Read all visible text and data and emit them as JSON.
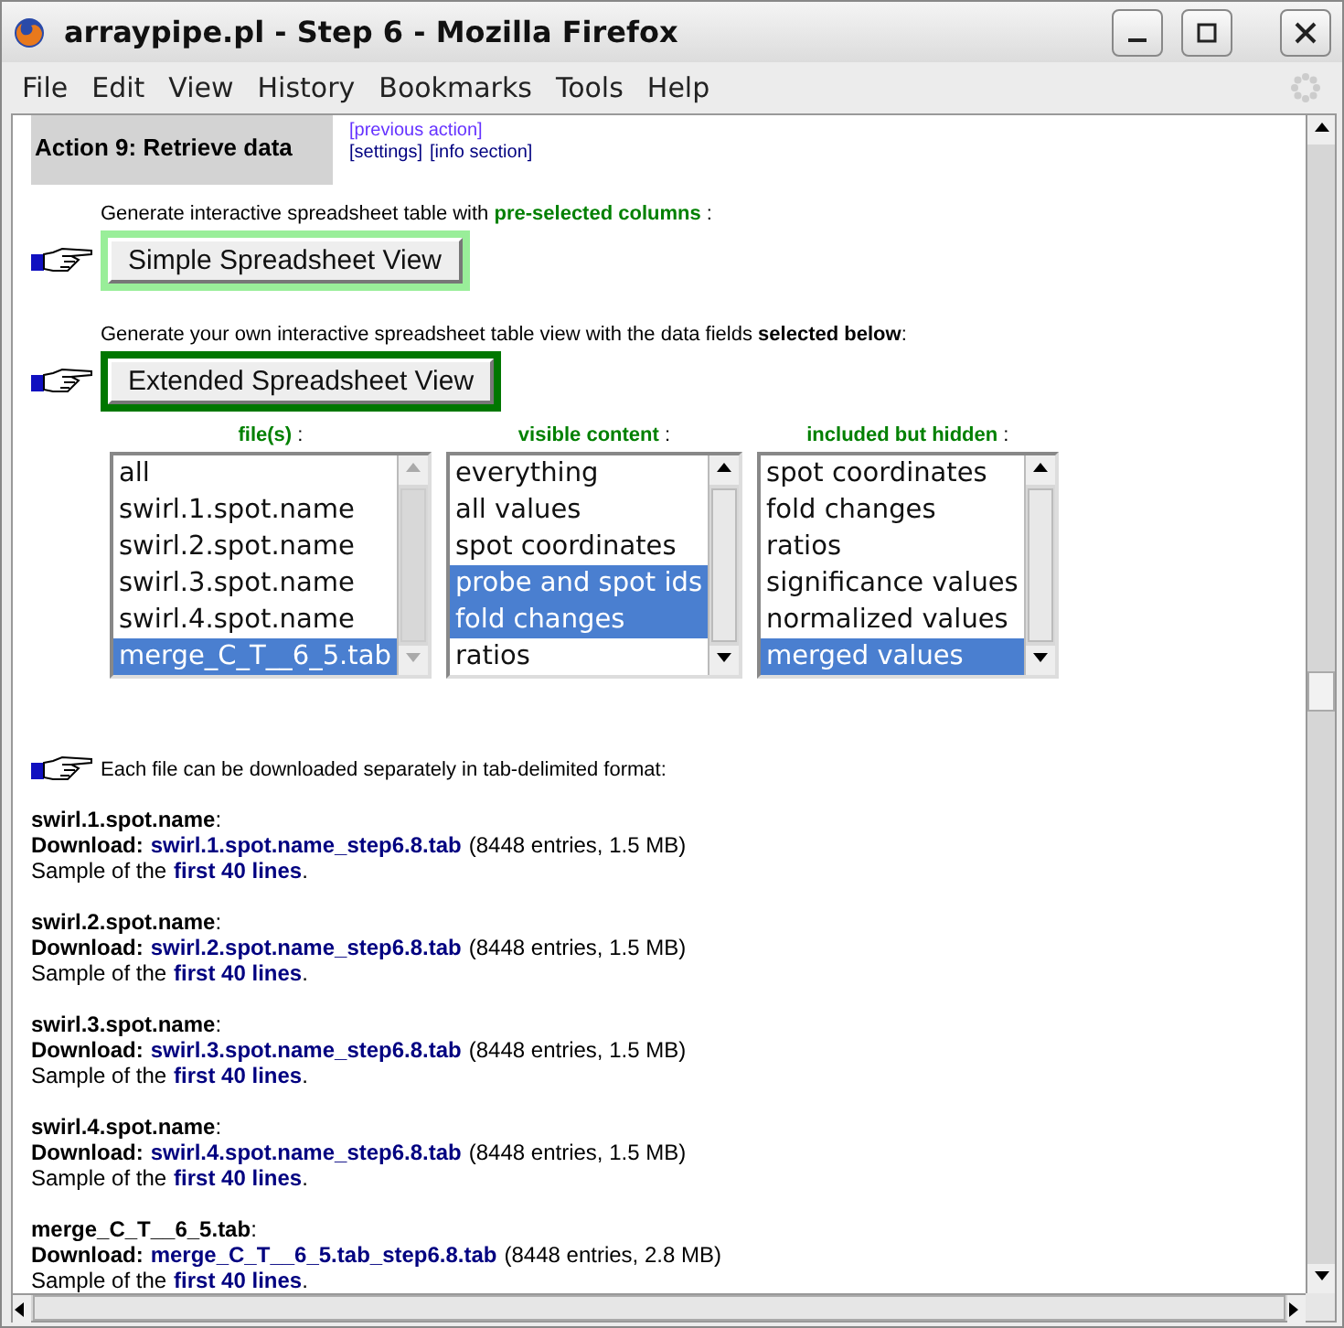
{
  "window": {
    "title": "arraypipe.pl - Step 6 - Mozilla Firefox"
  },
  "menu": [
    "File",
    "Edit",
    "View",
    "History",
    "Bookmarks",
    "Tools",
    "Help"
  ],
  "action": {
    "title": "Action 9: Retrieve data",
    "links": [
      {
        "label": "[previous action]",
        "visited": true
      },
      {
        "label": "[settings]",
        "visited": false
      },
      {
        "label": "[info section]",
        "visited": false
      }
    ]
  },
  "generators": [
    {
      "kind": "simple",
      "text": "Generate interactive spreadsheet table with **pre-selected columns** :",
      "button": "Simple Spreadsheet View"
    },
    {
      "kind": "extended",
      "text": "Generate your own interactive spreadsheet table view with the data fields **selected below**:",
      "button": "Extended Spreadsheet View"
    }
  ],
  "lists": [
    {
      "heading": "**file(s)** :",
      "disabled_scroll": true,
      "items": [
        {
          "label": "all",
          "selected": false
        },
        {
          "label": "swirl.1.spot.name",
          "selected": false
        },
        {
          "label": "swirl.2.spot.name",
          "selected": false
        },
        {
          "label": "swirl.3.spot.name",
          "selected": false
        },
        {
          "label": "swirl.4.spot.name",
          "selected": false
        },
        {
          "label": "merge_C_T__6_5.tab",
          "selected": true
        }
      ]
    },
    {
      "heading": "**visible content** :",
      "disabled_scroll": false,
      "items": [
        {
          "label": "everything",
          "selected": false
        },
        {
          "label": "all values",
          "selected": false
        },
        {
          "label": "spot coordinates",
          "selected": false
        },
        {
          "label": "probe and spot ids",
          "selected": true
        },
        {
          "label": "fold changes",
          "selected": true
        },
        {
          "label": "ratios",
          "selected": false
        }
      ]
    },
    {
      "heading": "**included but hidden** :",
      "disabled_scroll": false,
      "items": [
        {
          "label": "spot coordinates",
          "selected": false
        },
        {
          "label": "fold changes",
          "selected": false
        },
        {
          "label": "ratios",
          "selected": false
        },
        {
          "label": "significance values",
          "selected": false
        },
        {
          "label": "normalized values",
          "selected": false
        },
        {
          "label": "merged values",
          "selected": true
        }
      ]
    }
  ],
  "downloads": {
    "intro": "Each file can be downloaded separately in tab-delimited format:",
    "files": [
      {
        "name": "swirl.1.spot.name",
        "name_suffix": ":",
        "sample_suffix": ".",
        "download_label": "Download:",
        "link": "swirl.1.spot.name_step6.8.tab",
        "info": "(8448 entries, 1.5 MB)",
        "sample_prefix": "Sample of the",
        "sample_link": "first 40 lines"
      },
      {
        "name": "swirl.2.spot.name",
        "name_suffix": ":",
        "sample_suffix": ".",
        "download_label": "Download:",
        "link": "swirl.2.spot.name_step6.8.tab",
        "info": "(8448 entries, 1.5 MB)",
        "sample_prefix": "Sample of the",
        "sample_link": "first 40 lines"
      },
      {
        "name": "swirl.3.spot.name",
        "name_suffix": ":",
        "sample_suffix": ".",
        "download_label": "Download:",
        "link": "swirl.3.spot.name_step6.8.tab",
        "info": "(8448 entries, 1.5 MB)",
        "sample_prefix": "Sample of the",
        "sample_link": "first 40 lines"
      },
      {
        "name": "swirl.4.spot.name",
        "name_suffix": ":",
        "sample_suffix": ".",
        "download_label": "Download:",
        "link": "swirl.4.spot.name_step6.8.tab",
        "info": "(8448 entries, 1.5 MB)",
        "sample_prefix": "Sample of the",
        "sample_link": "first 40 lines"
      },
      {
        "name": "merge_C_T__6_5.tab",
        "name_suffix": ":",
        "sample_suffix": ".",
        "download_label": "Download:",
        "link": "merge_C_T__6_5.tab_step6.8.tab",
        "info": "(8448 entries, 2.8 MB)",
        "sample_prefix": "Sample of the",
        "sample_link": "first 40 lines"
      }
    ]
  }
}
